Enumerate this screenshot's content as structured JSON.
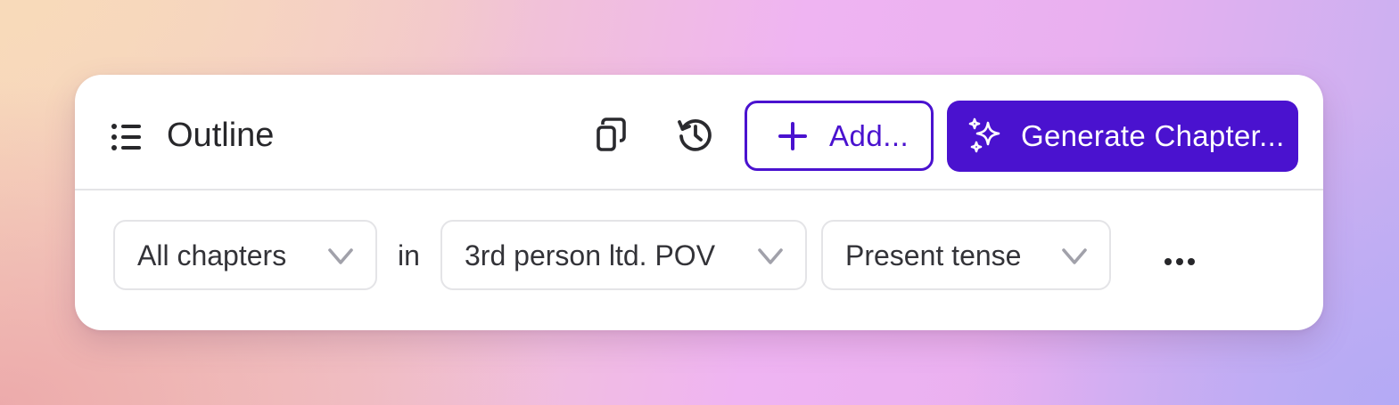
{
  "header": {
    "title": "Outline",
    "icons": {
      "list": "list-icon",
      "copy": "copy-icon",
      "history": "history-icon"
    },
    "add_button": {
      "icon": "plus-icon",
      "label": "Add..."
    },
    "generate_button": {
      "icon": "sparkles-icon",
      "label": "Generate Chapter..."
    }
  },
  "filters": {
    "chapters": {
      "label": "All chapters",
      "icon": "chevron-down-icon"
    },
    "connector": "in",
    "pov": {
      "label": "3rd person ltd. POV",
      "icon": "chevron-down-icon"
    },
    "tense": {
      "label": "Present tense",
      "icon": "chevron-down-icon"
    },
    "more": {
      "icon": "more-horizontal-icon"
    }
  },
  "colors": {
    "accent": "#4a12cf",
    "text": "#27272a",
    "border": "#e4e4e7",
    "muted_icon": "#a1a1aa"
  }
}
